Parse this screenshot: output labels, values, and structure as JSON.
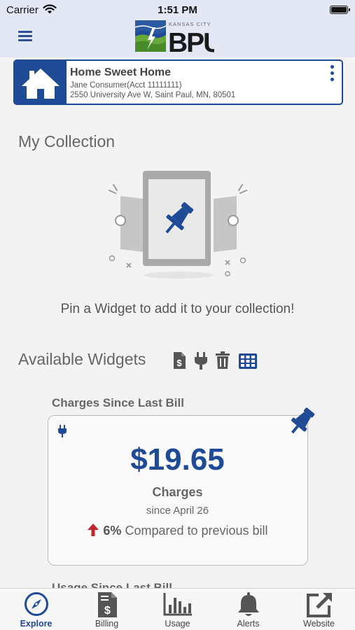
{
  "status_bar": {
    "carrier": "Carrier",
    "time": "1:51 PM"
  },
  "header": {
    "logo": {
      "small_text": "KANSAS CITY",
      "big_text": "BPU"
    }
  },
  "account": {
    "name": "Home Sweet Home",
    "holder": "Jane Consumer(Acct 11111111)",
    "address": "2550 University Ave W, Saint Paul, MN, 80501"
  },
  "collection": {
    "title": "My Collection",
    "empty_message": "Pin a Widget to add it to your collection!"
  },
  "available": {
    "title": "Available Widgets",
    "filters": [
      "billing-doc-icon",
      "plug-icon",
      "trash-icon",
      "grid-icon"
    ]
  },
  "widget": {
    "title": "Charges Since Last Bill",
    "amount": "$19.65",
    "label": "Charges",
    "since": "since April 26",
    "change_percent": "6%",
    "compare_text": "Compared to previous bill",
    "trend": "up"
  },
  "next_widget_title": "Usage Since Last Bill",
  "tabs": [
    {
      "label": "Explore",
      "icon": "compass-icon",
      "active": true
    },
    {
      "label": "Billing",
      "icon": "bill-icon",
      "active": false
    },
    {
      "label": "Usage",
      "icon": "bar-chart-icon",
      "active": false
    },
    {
      "label": "Alerts",
      "icon": "bell-icon",
      "active": false
    },
    {
      "label": "Website",
      "icon": "external-link-icon",
      "active": false
    }
  ],
  "colors": {
    "brand_blue": "#1f4a95",
    "up_arrow_red": "#c0262d",
    "header_bg": "#e4e7f4",
    "page_bg": "#f3f3f4"
  }
}
